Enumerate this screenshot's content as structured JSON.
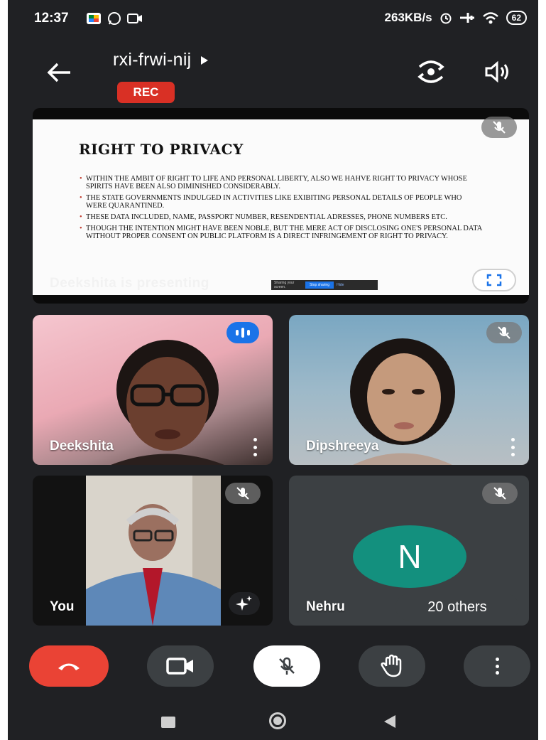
{
  "status_bar": {
    "time": "12:37",
    "network_speed": "263KB/s",
    "battery": "62"
  },
  "header": {
    "meeting_code": "rxi-frwi-nij",
    "recording_badge": "REC"
  },
  "presentation": {
    "slide_title": "RIGHT TO PRIVACY",
    "slide_bullets": [
      "WITHIN THE AMBIT OF RIGHT TO LIFE AND PERSONAL LIBERTY, ALSO WE HAHVE RIGHT TO PRIVACY WHOSE SPIRITS HAVE BEEN ALSO DIMINISHED CONSIDERABLY.",
      "THE STATE GOVERNMENTS INDULGED IN ACTIVITIES LIKE EXIBITING PERSONAL DETAILS OF PEOPLE WHO WERE QUARANTINED.",
      "THESE DATA INCLUDED, NAME, PASSPORT NUMBER, RESENDENTIAL ADRESSES, PHONE NUMBERS ETC.",
      "THOUGH THE INTENTION MIGHT HAVE BEEN NOBLE, BUT THE MERE ACT OF DISCLOSING ONE'S PERSONAL DATA WITHOUT PROPER CONSENT ON PUBLIC PLATFORM IS A DIRECT INFRINGEMENT OF RIGHT TO PRIVACY."
    ],
    "presenting_label": "Deekshita is presenting",
    "share_bar": {
      "text": "Sharing your screen.",
      "stop_label": "Stop sharing",
      "hide_label": "Hide"
    }
  },
  "participants": [
    {
      "name": "Deekshita",
      "speaking": true
    },
    {
      "name": "Dipshreeya",
      "muted": true
    },
    {
      "name": "You",
      "muted": true
    },
    {
      "name": "Nehru",
      "muted": true,
      "avatar_letter": "N",
      "others_label": "20 others"
    }
  ],
  "colors": {
    "background": "#202124",
    "tile": "#3c4043",
    "end_call": "#ea4335",
    "rec": "#d93025",
    "speaking_blue": "#1a73e8",
    "avatar_teal": "#13907e"
  },
  "icons": [
    "back-arrow-icon",
    "play-triangle-icon",
    "switch-camera-icon",
    "speaker-icon",
    "mic-off-icon",
    "fullscreen-icon",
    "more-vert-icon",
    "effects-sparkle-icon",
    "end-call-icon",
    "video-camera-icon",
    "raise-hand-icon"
  ]
}
